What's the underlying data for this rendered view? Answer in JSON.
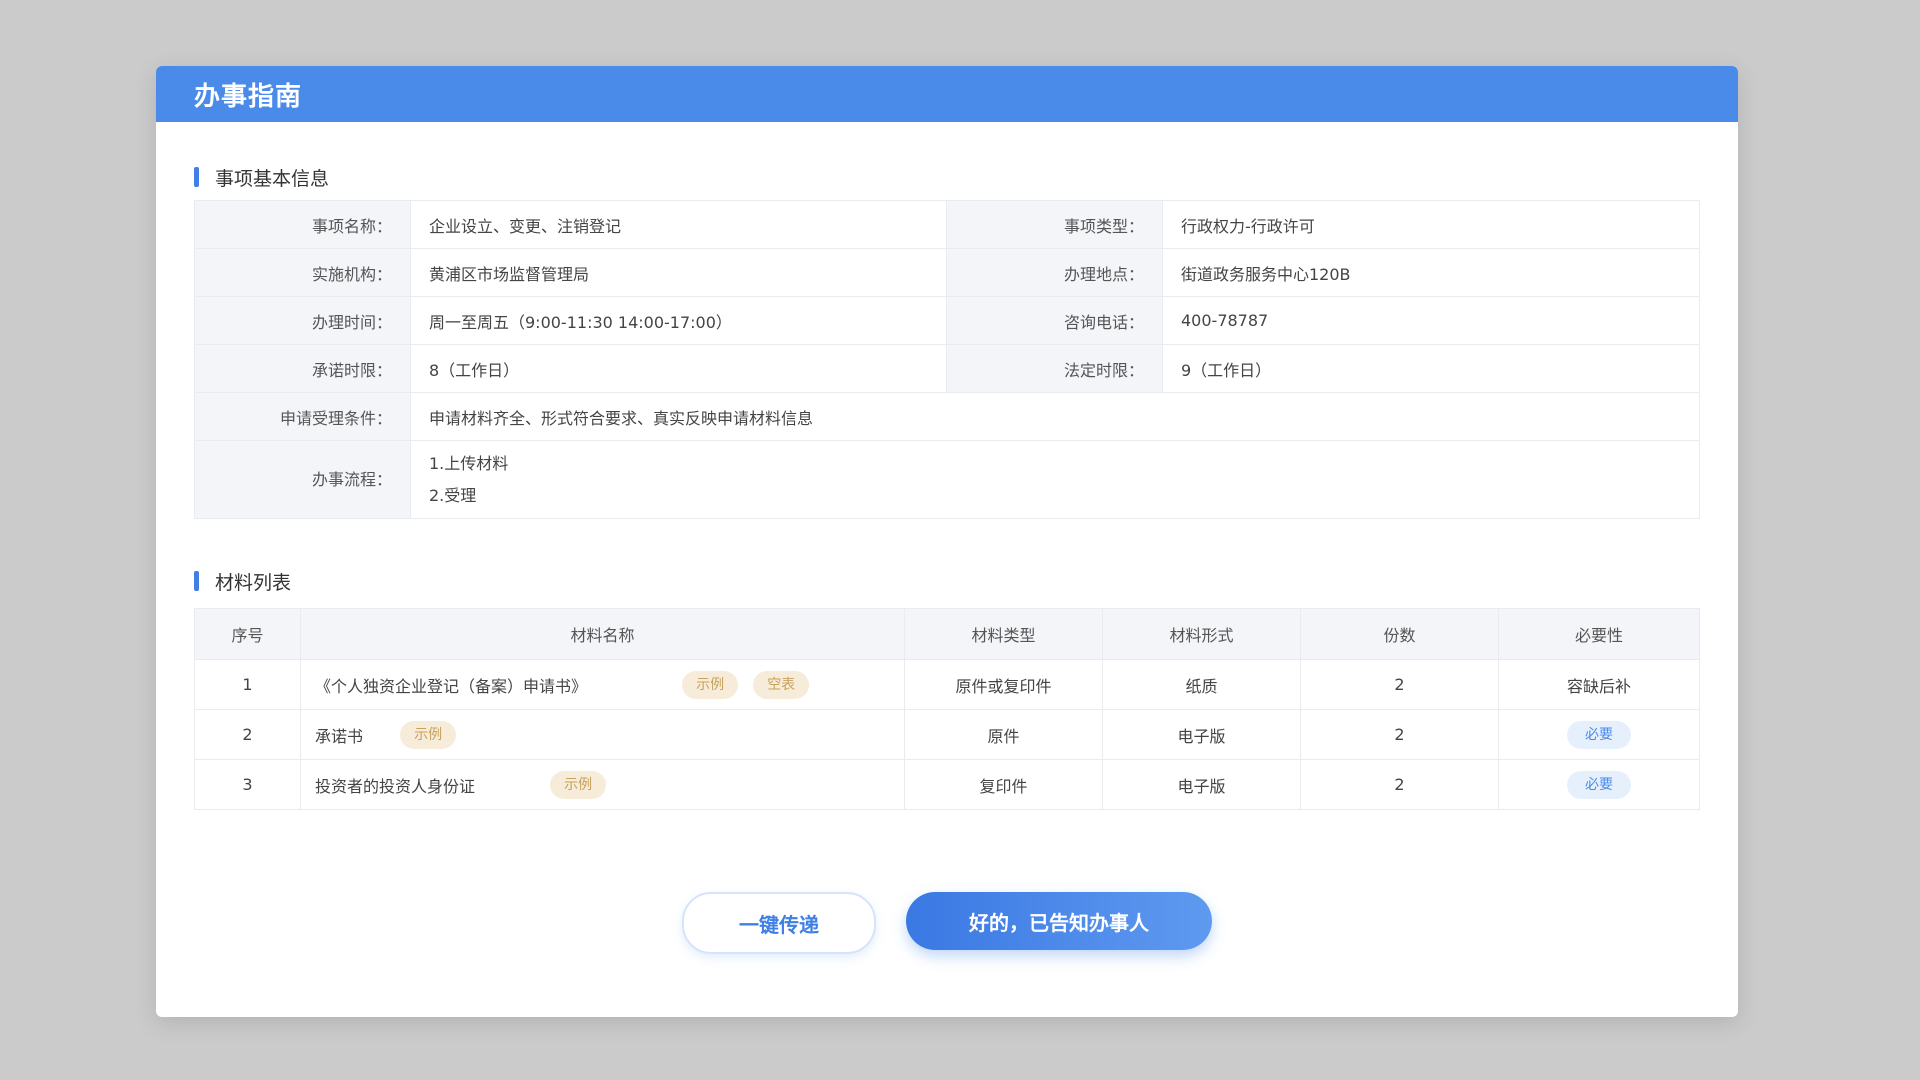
{
  "dialog": {
    "title": "办事指南"
  },
  "basic_info": {
    "section_title": "事项基本信息",
    "item_name_label": "事项名称：",
    "item_name_value": "企业设立、变更、注销登记",
    "item_type_label": "事项类型：",
    "item_type_value": "行政权力-行政许可",
    "agency_label": "实施机构：",
    "agency_value": "黄浦区市场监督管理局",
    "location_label": "办理地点：",
    "location_value": "街道政务服务中心120B",
    "hours_label": "办理时间：",
    "hours_value": "周一至周五（9:00-11:30    14:00-17:00）",
    "phone_label": "咨询电话：",
    "phone_value": "400-78787",
    "promised_label": "承诺时限：",
    "promised_value": "8（工作日）",
    "legal_label": "法定时限：",
    "legal_value": "9（工作日）",
    "conditions_label": "申请受理条件：",
    "conditions_value": "申请材料齐全、形式符合要求、真实反映申请材料信息",
    "process_label": "办事流程：",
    "process_step_1": "1.上传材料",
    "process_step_2": "2.受理"
  },
  "materials": {
    "section_title": "材料列表",
    "headers": {
      "index": "序号",
      "name": "材料名称",
      "type": "材料类型",
      "form": "材料形式",
      "copies": "份数",
      "required": "必要性"
    },
    "rows": [
      {
        "index": "1",
        "name": "《个人独资企业登记（备案）申请书》",
        "tags": [
          "示例",
          "空表"
        ],
        "type": "原件或复印件",
        "form": "纸质",
        "copies": "2",
        "required": "容缺后补"
      },
      {
        "index": "2",
        "name": "承诺书",
        "tags": [
          "示例"
        ],
        "type": "原件",
        "form": "电子版",
        "copies": "2",
        "required": "必要"
      },
      {
        "index": "3",
        "name": "投资者的投资人身份证",
        "tags": [
          "示例"
        ],
        "type": "复印件",
        "form": "电子版",
        "copies": "2",
        "required": "必要"
      }
    ]
  },
  "footer": {
    "send_button": "一键传递",
    "confirm_button": "好的，已告知办事人"
  },
  "colors": {
    "header_bg": "#4a8ae8",
    "accent": "#3f7fe6",
    "tag_bg": "#f6ecd9",
    "tag_text": "#c8a15c",
    "required_bg": "#e6f0fd"
  }
}
